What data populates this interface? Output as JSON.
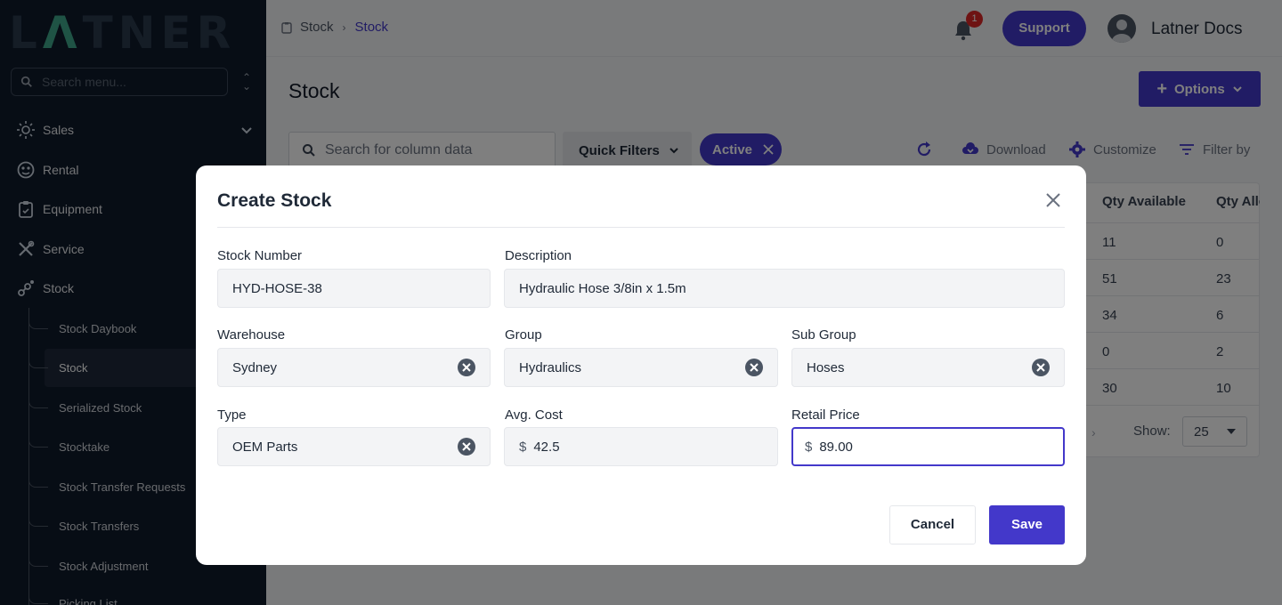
{
  "sidebar": {
    "logo": {
      "part1": "L",
      "tri": "Λ",
      "part2": "TNER"
    },
    "search_placeholder": "Search menu...",
    "items": [
      {
        "label": "Sales",
        "icon": "sun-icon"
      },
      {
        "label": "Rental",
        "icon": "rental-icon"
      },
      {
        "label": "Equipment",
        "icon": "clipboard-icon"
      },
      {
        "label": "Service",
        "icon": "tools-icon"
      },
      {
        "label": "Stock",
        "icon": "stock-icon"
      }
    ],
    "stock_subitems": [
      "Stock Daybook",
      "Stock",
      "Serialized Stock",
      "Stocktake",
      "Stock Transfer Requests",
      "Stock Transfers",
      "Stock Adjustment",
      "Picking List"
    ]
  },
  "topbar": {
    "breadcrumb": [
      "Stock",
      "Stock"
    ],
    "notification_count": "1",
    "support_label": "Support",
    "user_name": "Latner Docs"
  },
  "main": {
    "title": "Stock",
    "options_label": "Options",
    "search_placeholder": "Search for column data",
    "quick_filters_label": "Quick Filters",
    "active_chip_label": "Active",
    "download_label": "Download",
    "customize_label": "Customize",
    "filter_label": "Filter by",
    "table": {
      "headers": [
        "Qty Available",
        "Qty Allo"
      ],
      "rows": [
        [
          "11",
          "0"
        ],
        [
          "51",
          "23"
        ],
        [
          "34",
          "6"
        ],
        [
          "0",
          "2"
        ],
        [
          "30",
          "10"
        ]
      ]
    },
    "show_label": "Show:",
    "show_value": "25"
  },
  "modal": {
    "title": "Create Stock",
    "fields": {
      "stock_number": {
        "label": "Stock Number",
        "value": "HYD-HOSE-38"
      },
      "description": {
        "label": "Description",
        "value": "Hydraulic Hose 3/8in x 1.5m"
      },
      "warehouse": {
        "label": "Warehouse",
        "value": "Sydney"
      },
      "group": {
        "label": "Group",
        "value": "Hydraulics"
      },
      "sub_group": {
        "label": "Sub Group",
        "value": "Hoses"
      },
      "type": {
        "label": "Type",
        "value": "OEM Parts"
      },
      "avg_cost": {
        "label": "Avg. Cost",
        "currency": "$",
        "value": "42.5"
      },
      "retail_price": {
        "label": "Retail Price",
        "currency": "$",
        "value": "89.00"
      }
    },
    "cancel_label": "Cancel",
    "save_label": "Save"
  },
  "colors": {
    "primary": "#4338ca",
    "sidebar_bg": "#0f1a2a",
    "badge": "#dc2626"
  }
}
